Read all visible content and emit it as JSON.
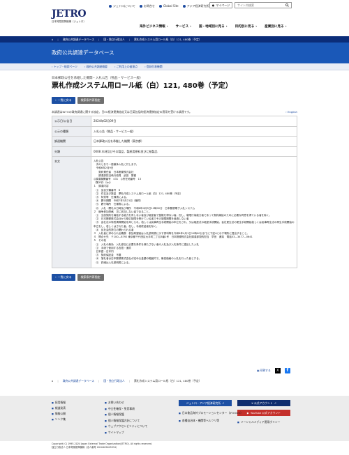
{
  "header": {
    "logo_text": "JETRO",
    "logo_sub": "日本貿易振興機構（ジェトロ）",
    "util_links": [
      "ジェトロについて",
      "お問合せ",
      "Global Site",
      "アジア経済研究所"
    ],
    "mypage_label": "マイページ",
    "search_placeholder": "サイト内検索",
    "gnav": [
      "海外ビジネス情報",
      "サービス",
      "国・地域別に見る",
      "目的別に見る",
      "産業別に見る"
    ]
  },
  "breadcrumb_top": [
    "政府公共調達データベース",
    "国・独立行政法人",
    "票札作成システム用ロール紙（白）121, 480巻（予定）"
  ],
  "band_title": "政府公共調達データベース",
  "subnav": [
    "トップ・検索ページ",
    "政府公共調達概要",
    "ご利用上の留意点",
    "登録付表機関"
  ],
  "page": {
    "subtitle": "日本郵政公社を承継した機関・入札公告（物品・サービス一般）",
    "title": "票札作成システム用ロール紙（白）121, 480巻（予定）",
    "back_button": "一覧に戻る",
    "conditions_button": "検索条件再指定",
    "note": "本調達はWTOの政府調達に関する協定、日EU経済連携協定又は日英包括的経済連携協定の適用を受ける調達です。",
    "english_link": "English"
  },
  "details": [
    {
      "label": "公示日/公告日",
      "value": "2024年02月09日"
    },
    {
      "label": "公示の種類",
      "value": "入札公告（物品・サービス一般）"
    },
    {
      "label": "調達機関",
      "value": "日本郵政公社を承継した機関（東京都）"
    },
    {
      "label": "分類",
      "value": "0008 木材及びその製品、製紙用原料並びに紙製品"
    }
  ],
  "body_label": "本文",
  "body_text": "入札公告\n　次のとおり一般競争入札に付します。\n　令和6年2月9日\n　　契約責任者　日本郵便株式会社\n　　調達部担当執行役員　武田　繁樹\n◎調達機関番号　431　◎所在地番号　13\n（第1号）（Ip)）\n１　調達内容\n　⑴　品目分類番号　6\n　⑵　件名及び数量　票札作成システム用ロール紙（白）121, 480巻（予定）\n　⑶　特質等　仕様書による。\n　⑷　履行期間　令和7年3月21日（最終）\n　⑸　履行場所　仕様書による。\n　⑹　入札・開札の日時及び場所　令和6年4月5日11時00分　日本郵便電子入札システム\n２　競争参加資格　次に該当しない者であること。\n　⑴　当該契約を締結する能力を有しない者及び破産者で復権を得ない者。但し、制限行為能力者であって契約締結のために必要な同意を得ている者を除く。\n　⑵　日本郵便株式会社から取引制限を受けている者でその制限期間を経過しない者\n　⑶　会社法の特別清算開始を命じられ、若しくは民事再生手続開始の申立をされ、又は破産法の破産手続開始、会社更生法の更生手続開始若しくは民事再生法の再生手続開始の申立をし、若しくはされた者。但し、手続終結者を除く。\n　⑷　反社会的勢力の関わられる者\n３　入札者に求められる義務　参加希望者は入札説明書に示す資料等を令和6年4月1日11時00分までに下記4に示す場所に提出すること。\n４　問合せ先　〒100—8792 東京都千代田区大手町二丁目3番1号　日本郵便株式会社調達部契約担当　早田　遼真　電話03—3477—0641\n５　その他\n　⑴　入札の無効　入札参加に必要な条件を満たさない者の入札及び入札条件に違反した入札\n　⑵　手続で使用する言語・通貨\n　日本語・日本円\n　⑶　契約保証金　不要\n　⑷　落札者は日本郵便株式会社が定める金額の範囲内で、最低価格の入札を行った者とする。\n　⑸　詳細は入札説明書による。",
  "share": {
    "bookmark_label": "印刷する",
    "x_label": "X",
    "fb_label": "f"
  },
  "breadcrumb_bottom": [
    "政府公共調達データベース",
    "国・独立行政法人",
    "票札作成システム用ロール紙（白）121, 480巻（予定）"
  ],
  "footer": {
    "col1": [
      "採用情報",
      "報道発表",
      "情報公開",
      "リンク集"
    ],
    "col2": [
      "お問い合わせ",
      "中立性確保・免責事項",
      "個人情報保護",
      "個人情報保護方針について",
      "ウェブアクセシビリティについて",
      "サイトマップ"
    ],
    "buttons": [
      "ジェトロ・アジア経済研究所",
      "X 公式アカウント",
      "YouTube 公式アカウント"
    ],
    "links": [
      "日本食品海外プロモーションセンター（JFOODO）",
      "各種自治体・機関等ヘルツリ等",
      "ソーシャルメディア運用ポリシー"
    ],
    "copyright": "Copyright (C) 1995-2024 Japan External Trade Organization(JETRO). All rights reserved.",
    "copyright2": "独立行政法人 日本貿易振興機構（法人番号 2010405005934）"
  }
}
